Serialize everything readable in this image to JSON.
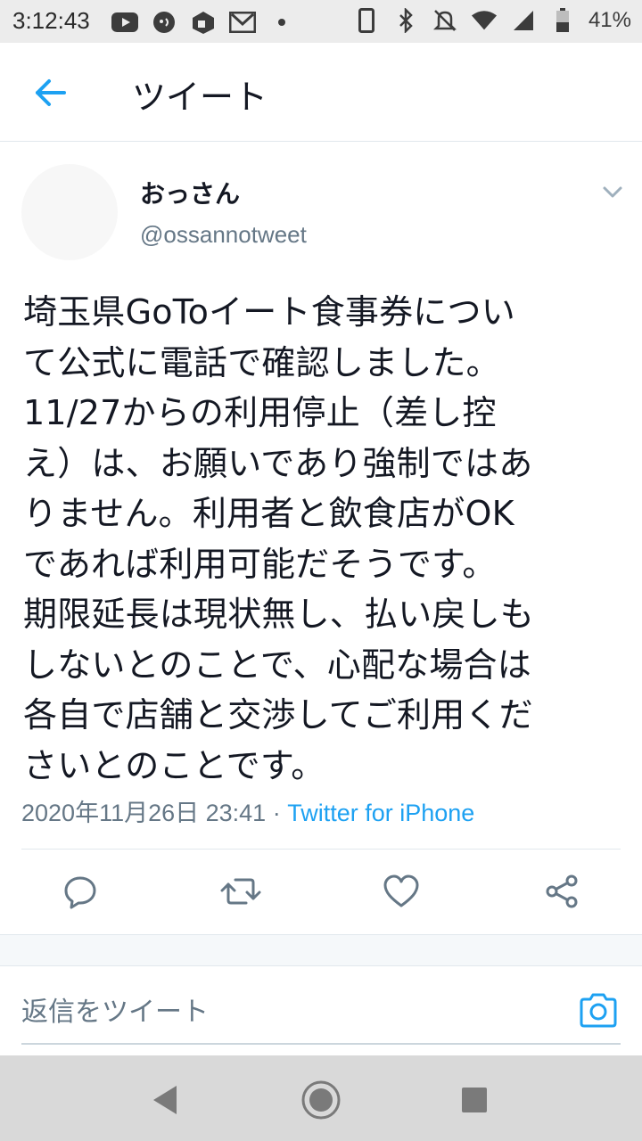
{
  "status_bar": {
    "time": "3:12:43",
    "battery_text": "41%",
    "left_icons": [
      "youtube-icon",
      "messenger-icon",
      "app-icon",
      "gmail-icon",
      "dot-icon"
    ],
    "right_icons": [
      "phone-icon",
      "bluetooth-icon",
      "mute-icon",
      "wifi-icon",
      "signal-icon",
      "battery-icon"
    ]
  },
  "header": {
    "title": "ツイート"
  },
  "tweet": {
    "name": "おっさん",
    "handle": "@ossannotweet",
    "text": "埼玉県GoToイート食事券につい\nて公式に電話で確認しました。\n11/27からの利用停止（差し控\nえ）は、お願いであり強制ではあ\nりません。利用者と飲食店がOK\nであれば利用可能だそうです。\n期限延長は現状無し、払い戻しも\nしないとのことで、心配な場合は\n各自で店舗と交渉してご利用くだ\nさいとのことです。",
    "timestamp": "2020年11月26日 23:41",
    "separator": " · ",
    "source": "Twitter for iPhone"
  },
  "reply": {
    "placeholder": "返信をツイート"
  },
  "colors": {
    "accent": "#1da1f2",
    "secondary_text": "#657786",
    "primary_text": "#141823",
    "divider": "#e1e8ed",
    "status_bar_bg": "#ececec",
    "nav_bar_bg": "#d9d9d9"
  }
}
